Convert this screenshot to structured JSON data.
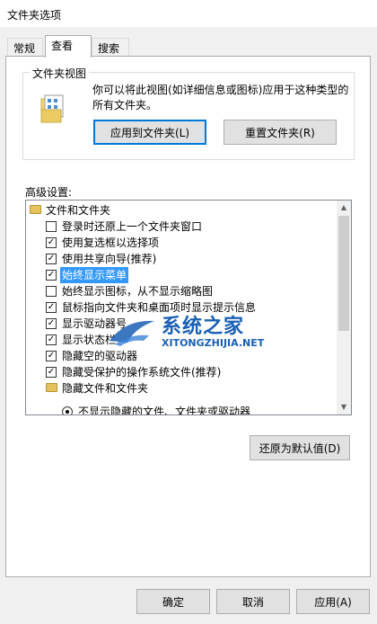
{
  "window": {
    "title": "文件夹选项"
  },
  "tabs": [
    {
      "label": "常规"
    },
    {
      "label": "查看"
    },
    {
      "label": "搜索"
    }
  ],
  "folder_views": {
    "title": "文件夹视图",
    "description": "你可以将此视图(如详细信息或图标)应用于这种类型的所有文件夹。",
    "apply_button": "应用到文件夹(L)",
    "reset_button": "重置文件夹(R)"
  },
  "advanced": {
    "label": "高级设置:",
    "items": [
      {
        "type": "folder",
        "label": "文件和文件夹",
        "indent": 0
      },
      {
        "type": "checkbox",
        "checked": false,
        "label": "登录时还原上一个文件夹窗口"
      },
      {
        "type": "checkbox",
        "checked": true,
        "label": "使用复选框以选择项"
      },
      {
        "type": "checkbox",
        "checked": true,
        "label": "使用共享向导(推荐)"
      },
      {
        "type": "checkbox",
        "checked": true,
        "label": "始终显示菜单",
        "selected": true
      },
      {
        "type": "checkbox",
        "checked": false,
        "label": "始终显示图标，从不显示缩略图"
      },
      {
        "type": "checkbox",
        "checked": true,
        "label": "鼠标指向文件夹和桌面项时显示提示信息"
      },
      {
        "type": "checkbox",
        "checked": true,
        "label": "显示驱动器号"
      },
      {
        "type": "checkbox",
        "checked": true,
        "label": "显示状态栏"
      },
      {
        "type": "checkbox",
        "checked": true,
        "label": "隐藏空的驱动器"
      },
      {
        "type": "checkbox",
        "checked": true,
        "label": "隐藏受保护的操作系统文件(推荐)"
      },
      {
        "type": "folder",
        "label": "隐藏文件和文件夹"
      },
      {
        "type": "radio",
        "label": "不显示隐藏的文件、文件夹或驱动器"
      }
    ],
    "restore_button": "还原为默认值(D)"
  },
  "footer": {
    "ok": "确定",
    "cancel": "取消",
    "apply": "应用(A)"
  },
  "watermark": {
    "cn": "系统之家",
    "en": "XITONGZHIJIA.NET"
  }
}
